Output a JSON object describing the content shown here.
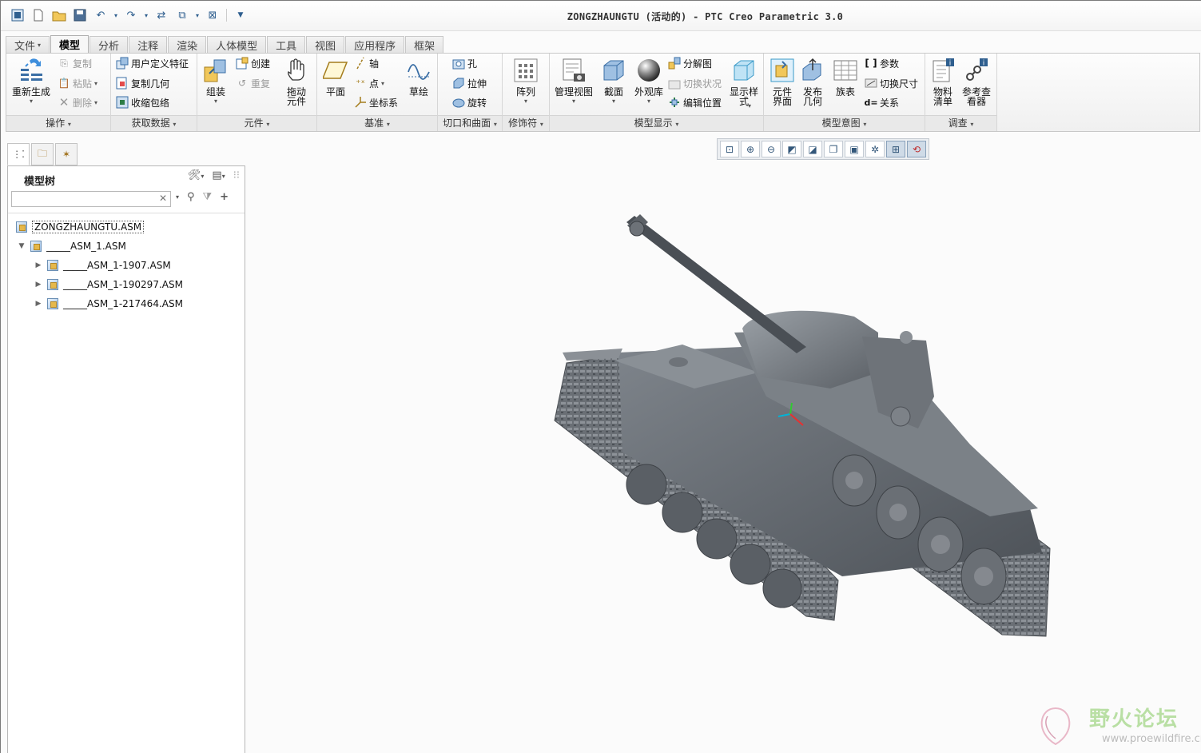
{
  "window": {
    "title": "ZONGZHAUNGTU (活动的) - PTC Creo Parametric 3.0"
  },
  "tabs": [
    {
      "label": "文件",
      "caret": "▾"
    },
    {
      "label": "模型"
    },
    {
      "label": "分析"
    },
    {
      "label": "注释"
    },
    {
      "label": "渲染"
    },
    {
      "label": "人体模型"
    },
    {
      "label": "工具"
    },
    {
      "label": "视图"
    },
    {
      "label": "应用程序"
    },
    {
      "label": "框架"
    }
  ],
  "ribbon": {
    "groups": {
      "operations": "操作",
      "get_data": "获取数据",
      "component": "元件",
      "datum": "基准",
      "cut_surface": "切口和曲面",
      "modifier": "修饰符",
      "model_display": "模型显示",
      "model_intent": "模型意图",
      "investigate": "调查"
    },
    "regenerate": "重新生成",
    "copy": "复制",
    "paste": "粘贴",
    "delete": "删除",
    "user_defined_feature": "用户定义特征",
    "copy_geometry": "复制几何",
    "shrinkwrap": "收缩包络",
    "assemble": "组装",
    "create": "创建",
    "repeat": "重复",
    "drag_components_1": "拖动",
    "drag_components_2": "元件",
    "plane": "平面",
    "axis": "轴",
    "point": "点",
    "csys": "坐标系",
    "sketch": "草绘",
    "hole": "孔",
    "extrude": "拉伸",
    "revolve": "旋转",
    "pattern": "阵列",
    "manage_views": "管理视图",
    "section": "截面",
    "appearance_gallery": "外观库",
    "exploded_view": "分解图",
    "toggle_status": "切换状况",
    "edit_position": "编辑位置",
    "display_style_1": "显示样",
    "display_style_2": "式",
    "component_interface_1": "元件",
    "component_interface_2": "界面",
    "publish_geometry_1": "发布",
    "publish_geometry_2": "几何",
    "family_table": "族表",
    "parameters": "参数",
    "switch_dimensions": "切换尺寸",
    "relations": "关系",
    "bom_1": "物料",
    "bom_2": "清单",
    "reference_viewer_1": "参考查",
    "reference_viewer_2": "看器"
  },
  "panel": {
    "title": "模型树",
    "search_placeholder": "",
    "tree": [
      {
        "label": "ZONGZHAUNGTU.ASM",
        "level": 0,
        "expand": ""
      },
      {
        "label": "_____ASM_1.ASM",
        "level": 1,
        "expand": "▼"
      },
      {
        "label": "_____ASM_1-1907.ASM",
        "level": 2,
        "expand": "▶"
      },
      {
        "label": "_____ASM_1-190297.ASM",
        "level": 2,
        "expand": "▶"
      },
      {
        "label": "_____ASM_1-217464.ASM",
        "level": 2,
        "expand": "▶"
      }
    ]
  },
  "view_toolbar": [
    {
      "icon": "refit-icon"
    },
    {
      "icon": "zoom-in-icon"
    },
    {
      "icon": "zoom-out-icon"
    },
    {
      "icon": "repaint-icon"
    },
    {
      "icon": "display-style-icon"
    },
    {
      "icon": "saved-orientations-icon"
    },
    {
      "icon": "view-manager-icon"
    },
    {
      "icon": "datum-display-icon"
    },
    {
      "icon": "spin-center-icon"
    },
    {
      "icon": "annotation-display-icon"
    }
  ],
  "watermark": {
    "text": "野火论坛",
    "url": "www.proewildfire.cn"
  },
  "colors": {
    "model": "#5f646a",
    "background": "#fbfbfb",
    "active_tab": "#f7f7f7"
  }
}
